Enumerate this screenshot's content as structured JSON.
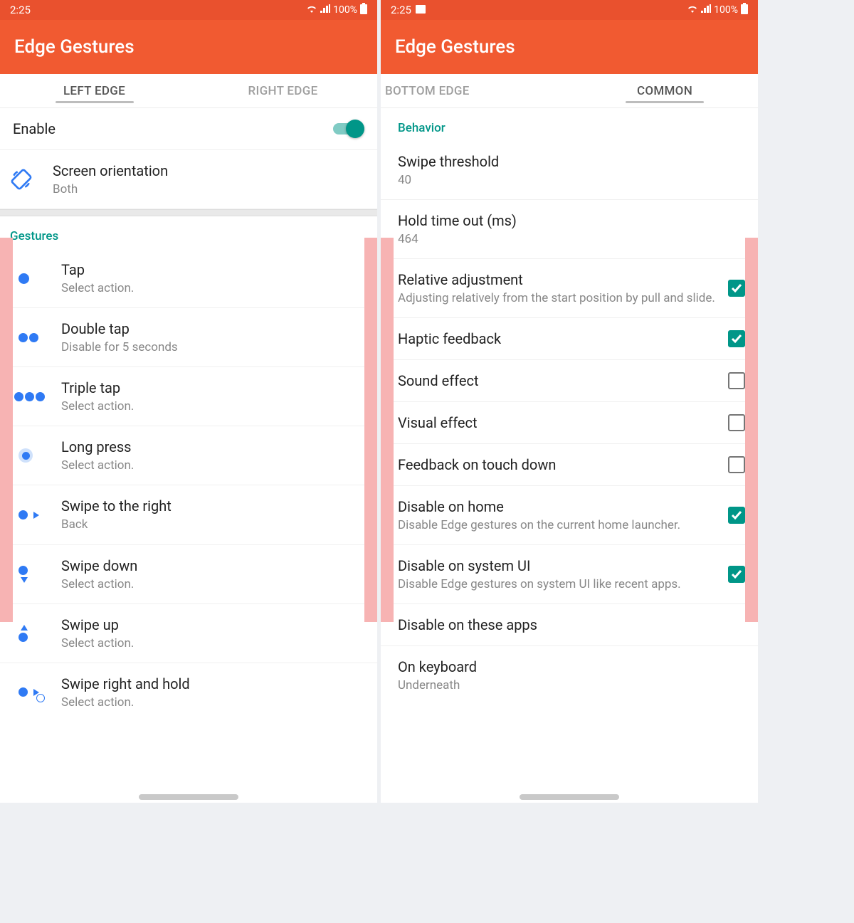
{
  "status": {
    "time": "2:25",
    "battery": "100%"
  },
  "app_title": "Edge Gestures",
  "left": {
    "tabs": {
      "left": "LEFT EDGE",
      "right": "RIGHT EDGE"
    },
    "enable_label": "Enable",
    "orientation": {
      "title": "Screen orientation",
      "value": "Both"
    },
    "section": "Gestures",
    "items": [
      {
        "title": "Tap",
        "sub": "Select action."
      },
      {
        "title": "Double tap",
        "sub": "Disable for 5 seconds"
      },
      {
        "title": "Triple tap",
        "sub": "Select action."
      },
      {
        "title": "Long press",
        "sub": "Select action."
      },
      {
        "title": "Swipe to the right",
        "sub": "Back"
      },
      {
        "title": "Swipe down",
        "sub": "Select action."
      },
      {
        "title": "Swipe up",
        "sub": "Select action."
      },
      {
        "title": "Swipe right and hold",
        "sub": "Select action."
      }
    ]
  },
  "right": {
    "tabs": {
      "left": "BOTTOM EDGE",
      "right": "COMMON"
    },
    "section": "Behavior",
    "threshold": {
      "title": "Swipe threshold",
      "value": "40"
    },
    "holdtime": {
      "title": "Hold time out (ms)",
      "value": "464"
    },
    "relative": {
      "title": "Relative adjustment",
      "sub": "Adjusting relatively from the start position by pull and slide."
    },
    "haptic": {
      "title": "Haptic feedback"
    },
    "sound": {
      "title": "Sound effect"
    },
    "visual": {
      "title": "Visual effect"
    },
    "touchdown": {
      "title": "Feedback on touch down"
    },
    "disable_home": {
      "title": "Disable on home",
      "sub": "Disable Edge gestures on the current home launcher."
    },
    "disable_sysui": {
      "title": "Disable on system UI",
      "sub": "Disable Edge gestures on system UI like recent apps."
    },
    "disable_apps": {
      "title": "Disable on these apps"
    },
    "keyboard": {
      "title": "On keyboard",
      "value": "Underneath"
    }
  }
}
